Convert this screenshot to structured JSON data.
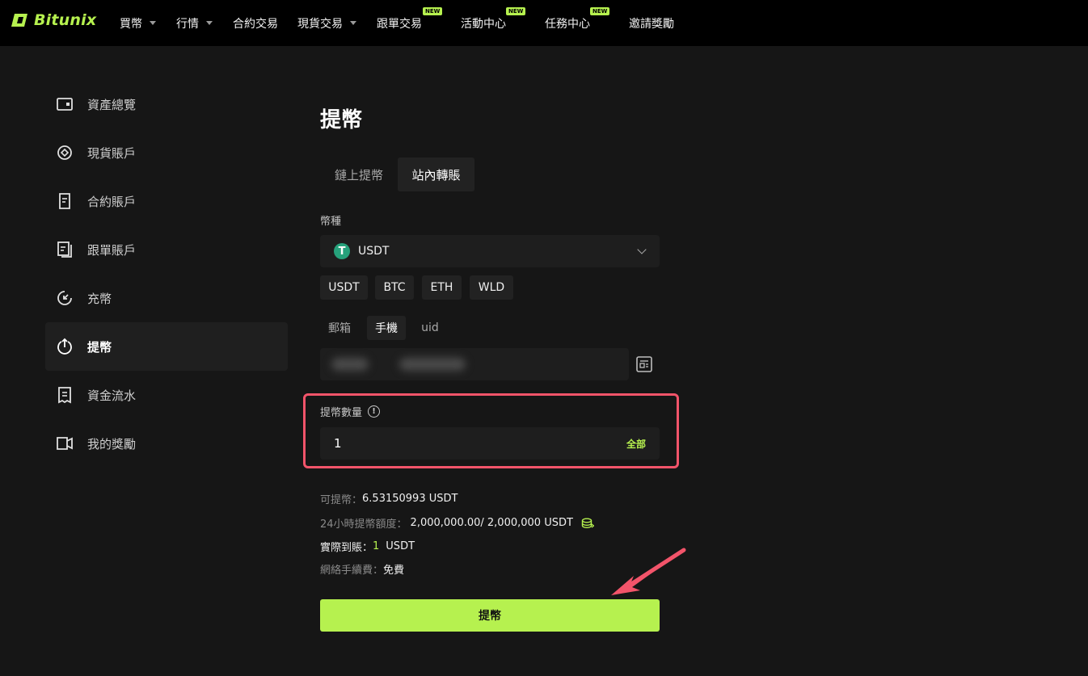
{
  "brand": {
    "name": "Bitunix",
    "accent": "#b6f14f"
  },
  "topnav": {
    "items": [
      {
        "label": "買幣",
        "dropdown": true,
        "badge": ""
      },
      {
        "label": "行情",
        "dropdown": true,
        "badge": ""
      },
      {
        "label": "合約交易",
        "dropdown": false,
        "badge": ""
      },
      {
        "label": "現貨交易",
        "dropdown": true,
        "badge": ""
      },
      {
        "label": "跟單交易",
        "dropdown": false,
        "badge": "NEW"
      },
      {
        "label": "活動中心",
        "dropdown": false,
        "badge": "NEW"
      },
      {
        "label": "任務中心",
        "dropdown": false,
        "badge": "NEW"
      },
      {
        "label": "邀請獎勵",
        "dropdown": false,
        "badge": ""
      }
    ]
  },
  "sidebar": {
    "items": [
      {
        "label": "資產總覽",
        "icon": "wallet-icon",
        "active": false
      },
      {
        "label": "現貨賬戶",
        "icon": "spot-icon",
        "active": false
      },
      {
        "label": "合約賬戶",
        "icon": "contract-icon",
        "active": false
      },
      {
        "label": "跟單賬戶",
        "icon": "copy-icon",
        "active": false
      },
      {
        "label": "充幣",
        "icon": "deposit-icon",
        "active": false
      },
      {
        "label": "提幣",
        "icon": "withdraw-icon",
        "active": true
      },
      {
        "label": "資金流水",
        "icon": "receipt-icon",
        "active": false
      },
      {
        "label": "我的獎勵",
        "icon": "reward-icon",
        "active": false
      }
    ]
  },
  "main": {
    "title": "提幣",
    "tabs": [
      {
        "label": "鏈上提幣",
        "active": false
      },
      {
        "label": "站內轉賬",
        "active": true
      }
    ],
    "coin_label": "幣種",
    "coin_selected": "USDT",
    "coin_symbol": "T",
    "coin_chips": [
      "USDT",
      "BTC",
      "ETH",
      "WLD"
    ],
    "recipient_tabs": [
      {
        "label": "郵箱",
        "active": false
      },
      {
        "label": "手機",
        "active": true
      },
      {
        "label": "uid",
        "active": false
      }
    ],
    "amount_label": "提幣數量",
    "amount_value": "1",
    "all_label": "全部",
    "available_label": "可提幣：",
    "available_value": "6.53150993 USDT",
    "limit_label": "24小時提幣額度：",
    "limit_value": "2,000,000.00/ 2,000,000 USDT",
    "received_label": "實際到賬：",
    "received_value": "1",
    "received_unit": "USDT",
    "fee_label": "網絡手續費：",
    "fee_value": "免費",
    "submit_label": "提幣",
    "highlight_color": "#f2546a"
  }
}
